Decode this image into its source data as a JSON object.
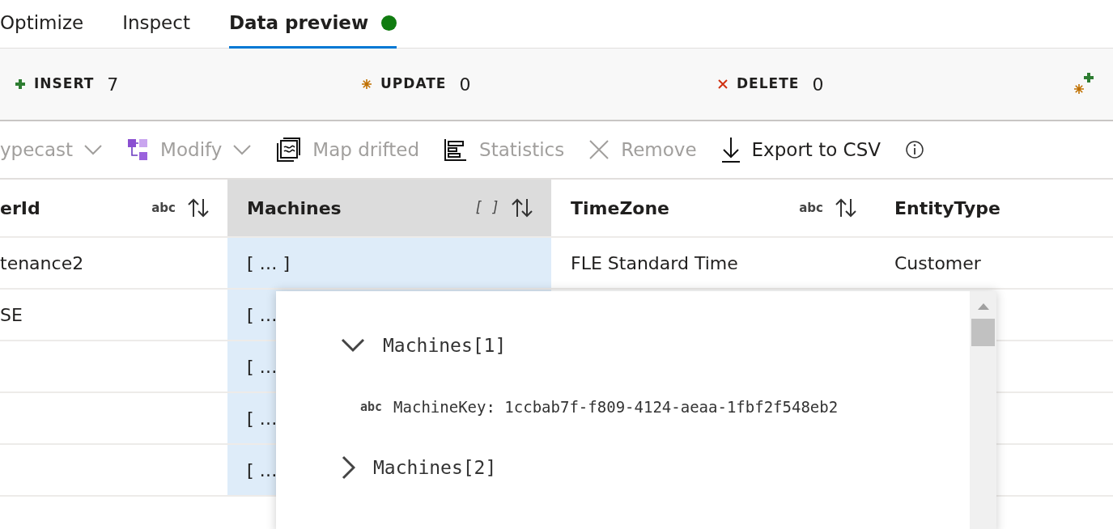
{
  "tabs": [
    {
      "label": "Optimize",
      "selected": false,
      "status_dot": false
    },
    {
      "label": "Inspect",
      "selected": false,
      "status_dot": false
    },
    {
      "label": "Data preview",
      "selected": true,
      "status_dot": true
    }
  ],
  "counts": [
    {
      "kind": "insert",
      "label": "INSERT",
      "value": "7"
    },
    {
      "kind": "update",
      "label": "UPDATE",
      "value": "0"
    },
    {
      "kind": "delete",
      "label": "DELETE",
      "value": "0"
    },
    {
      "kind": "upsert"
    }
  ],
  "toolbar": [
    {
      "kind": "typecast",
      "label": "ypecast",
      "disabled": true,
      "dropdown": true
    },
    {
      "kind": "modify",
      "label": "Modify",
      "disabled": true,
      "dropdown": true
    },
    {
      "kind": "map",
      "label": "Map drifted",
      "disabled": true,
      "dropdown": false
    },
    {
      "kind": "statistics",
      "label": "Statistics",
      "disabled": true,
      "dropdown": false
    },
    {
      "kind": "remove",
      "label": "Remove",
      "disabled": true,
      "dropdown": false
    },
    {
      "kind": "export",
      "label": "Export to CSV",
      "disabled": false,
      "dropdown": false
    },
    {
      "kind": "info"
    }
  ],
  "table": {
    "columns": [
      {
        "label": "erId",
        "type": "abc",
        "selected": false,
        "sortable": true
      },
      {
        "label": "Machines",
        "type": "[ ]",
        "selected": true,
        "sortable": true
      },
      {
        "label": "TimeZone",
        "type": "abc",
        "selected": false,
        "sortable": true
      },
      {
        "label": "EntityType",
        "selected": false,
        "sortable": false
      }
    ],
    "rows": [
      [
        "tenance2",
        "[ … ]",
        "FLE Standard Time",
        "Customer"
      ],
      [
        "SE",
        "[ …",
        "",
        ""
      ],
      [
        "",
        "[ …",
        "",
        ""
      ],
      [
        "",
        "[ …",
        "",
        ""
      ],
      [
        "",
        "[ …",
        "",
        ""
      ]
    ]
  },
  "popup": {
    "items": [
      {
        "label": "Machines[1]",
        "expanded": true,
        "children": [
          {
            "type": "abc",
            "label": "MachineKey: 1ccbab7f-f809-4124-aeaa-1fbf2f548eb2"
          }
        ]
      },
      {
        "label": "Machines[2]",
        "expanded": false
      }
    ]
  }
}
